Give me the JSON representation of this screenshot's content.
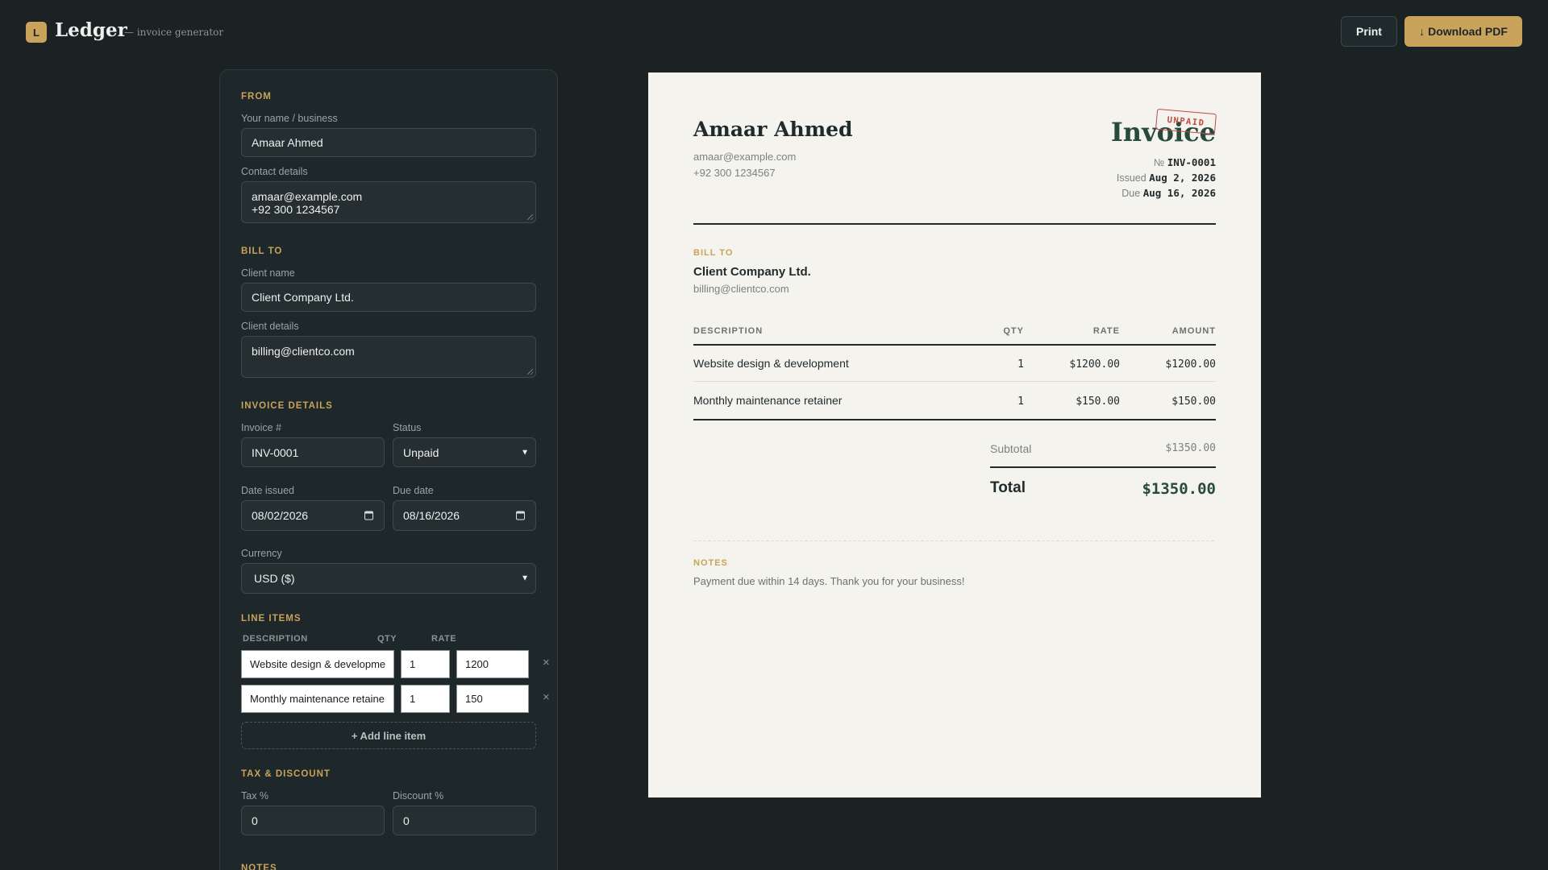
{
  "header": {
    "logo_letter": "L",
    "brand": "Ledger",
    "tagline": "— invoice generator",
    "print_label": "Print",
    "download_label": "Download PDF",
    "download_icon": "arrow-down-icon"
  },
  "form": {
    "from": {
      "section": "FROM",
      "name_label": "Your name / business",
      "name_value": "Amaar Ahmed",
      "contact_label": "Contact details",
      "contact_value": "amaar@example.com\n+92 300 1234567"
    },
    "bill_to": {
      "section": "BILL TO",
      "client_label": "Client name",
      "client_value": "Client Company Ltd.",
      "details_label": "Client details",
      "details_value": "billing@clientco.com"
    },
    "details": {
      "section": "INVOICE DETAILS",
      "invoice_label": "Invoice #",
      "invoice_value": "INV-0001",
      "status_label": "Status",
      "status_value": "Unpaid",
      "issued_label": "Date issued",
      "issued_value": "08/02/2026",
      "due_label": "Due date",
      "due_value": "08/16/2026",
      "currency_label": "Currency",
      "currency_value": "USD ($)"
    },
    "line_items": {
      "section": "LINE ITEMS",
      "col_description": "DESCRIPTION",
      "col_qty": "QTY",
      "col_rate": "RATE",
      "items": [
        {
          "description": "Website design & developme",
          "qty": "1",
          "rate": "1200"
        },
        {
          "description": "Monthly maintenance retaine",
          "qty": "1",
          "rate": "150"
        }
      ],
      "remove_glyph": "×",
      "add_label": "+ Add line item"
    },
    "tax": {
      "section": "TAX & DISCOUNT",
      "tax_label": "Tax %",
      "tax_value": "0",
      "discount_label": "Discount %",
      "discount_value": "0"
    },
    "notes": {
      "section": "NOTES"
    }
  },
  "invoice": {
    "from_name": "Amaar Ahmed",
    "from_contact": "amaar@example.com\n+92 300 1234567",
    "title": "Invoice",
    "status_stamp": "UNPAID",
    "number_label": "№",
    "number_value": "INV-0001",
    "issued_label": "Issued",
    "issued_value": "Aug 2, 2026",
    "due_label": "Due",
    "due_value": "Aug 16, 2026",
    "bill_to_label": "BILL TO",
    "client_name": "Client Company Ltd.",
    "client_email": "billing@clientco.com",
    "table_headers": {
      "description": "DESCRIPTION",
      "qty": "QTY",
      "rate": "RATE",
      "amount": "AMOUNT"
    },
    "rows": [
      {
        "description": "Website design & development",
        "qty": "1",
        "rate": "$1200.00",
        "amount": "$1200.00"
      },
      {
        "description": "Monthly maintenance retainer",
        "qty": "1",
        "rate": "$150.00",
        "amount": "$150.00"
      }
    ],
    "subtotal_label": "Subtotal",
    "subtotal_value": "$1350.00",
    "total_label": "Total",
    "total_value": "$1350.00",
    "notes_label": "NOTES",
    "notes_text": "Payment due within 14 days. Thank you for your business!"
  },
  "colors": {
    "background": "#1a2224",
    "accent": "#c9a25c",
    "paper": "#f5f3ee",
    "total_green": "#274a3e",
    "stamp_red": "#c04a42"
  }
}
